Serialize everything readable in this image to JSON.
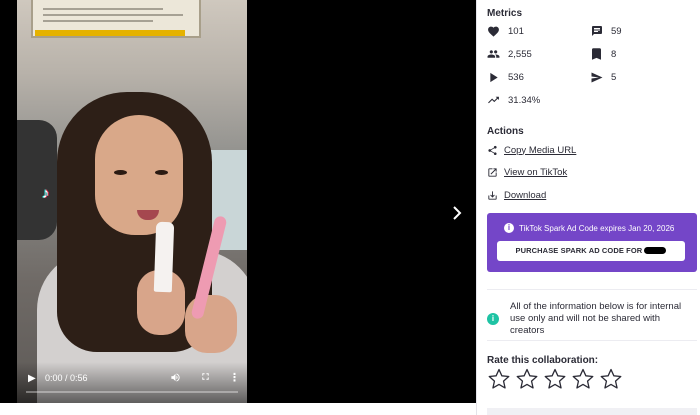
{
  "video": {
    "time": "0:00 / 0:56",
    "progress": 0,
    "icons": {
      "play": "play-icon",
      "volume": "volume-icon",
      "fullscreen": "fullscreen-icon",
      "more": "more-vert-icon",
      "next": "chevron-right-icon",
      "tiktok": "tiktok-logo"
    }
  },
  "metrics": {
    "title": "Metrics",
    "likes": "101",
    "comments": "59",
    "followers": "2,555",
    "saves": "8",
    "views": "536",
    "shares": "5",
    "engagement": "31.34%"
  },
  "actions": {
    "title": "Actions",
    "copy_url": "Copy Media URL",
    "view_tiktok": "View on TikTok",
    "download": "Download"
  },
  "spark": {
    "expires_text": "TikTok Spark Ad Code expires Jan 20, 2026",
    "button_label": "PURCHASE SPARK AD CODE FOR",
    "background": "#7446c8"
  },
  "notice": {
    "text": "All of the information below is for internal use only and will not be shared with creators",
    "icon": "info-icon",
    "color": "#1ec3a4"
  },
  "rating": {
    "title": "Rate this collaboration:",
    "max_stars": 5,
    "value": 0
  }
}
